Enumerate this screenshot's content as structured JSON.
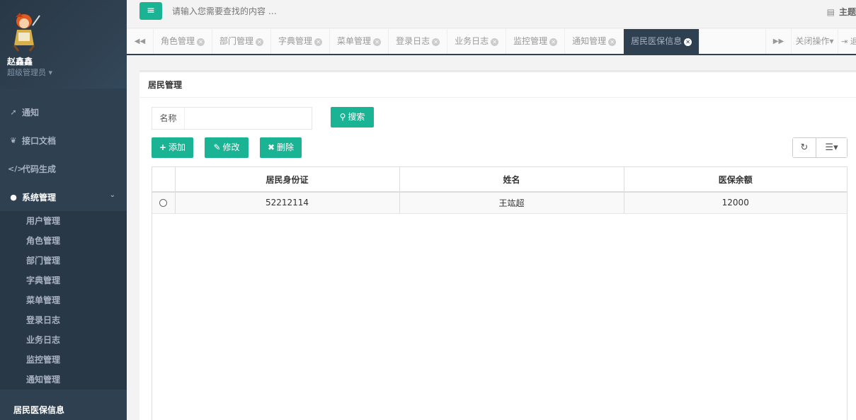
{
  "profile": {
    "name": "赵鑫鑫",
    "role": "超级管理员"
  },
  "menu": {
    "items": [
      {
        "icon": "send-icon",
        "glyph": "➚",
        "label": "通知"
      },
      {
        "icon": "leaf-icon",
        "glyph": "❦",
        "label": "接口文档"
      },
      {
        "icon": "code-icon",
        "glyph": "</>",
        "label": "代码生成"
      },
      {
        "icon": "user-icon",
        "glyph": "●",
        "label": "系统管理"
      }
    ],
    "sub_items": [
      "用户管理",
      "角色管理",
      "部门管理",
      "字典管理",
      "菜单管理",
      "登录日志",
      "业务日志",
      "监控管理",
      "通知管理"
    ],
    "last_item": "居民医保信息"
  },
  "topbar": {
    "search_placeholder": "请输入您需要查找的内容 …",
    "theme_label": "主题"
  },
  "tabs": {
    "items": [
      "角色管理",
      "部门管理",
      "字典管理",
      "菜单管理",
      "登录日志",
      "业务日志",
      "监控管理",
      "通知管理",
      "居民医保信息"
    ],
    "active_index": 8,
    "close_ops_label": "关闭操作",
    "exit_label": "退出"
  },
  "panel": {
    "title": "居民管理",
    "filter_label": "名称",
    "filter_value": "",
    "search_label": "搜索",
    "add_label": "添加",
    "edit_label": "修改",
    "delete_label": "删除"
  },
  "table": {
    "headers": [
      "居民身份证",
      "姓名",
      "医保余额"
    ],
    "rows": [
      [
        "52212114",
        "王竑超",
        "12000"
      ]
    ]
  },
  "colors": {
    "accent": "#1ab394",
    "sidebar": "#2f4050",
    "active_tab": "#2f4050"
  }
}
